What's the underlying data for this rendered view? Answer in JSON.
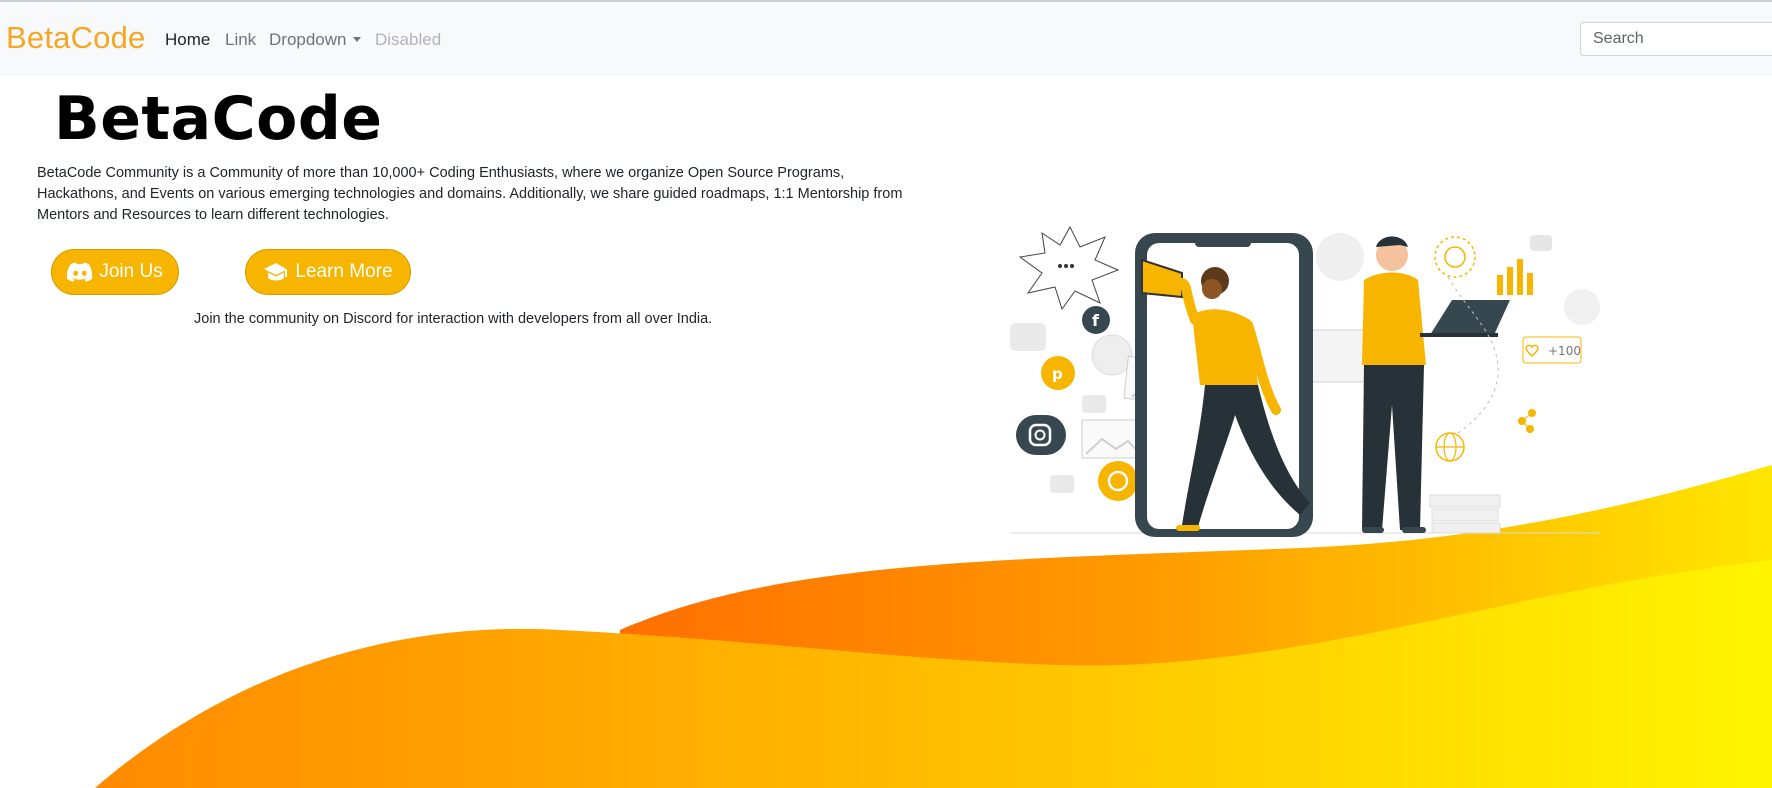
{
  "navbar": {
    "brand": "BetaCode",
    "links": [
      {
        "label": "Home",
        "state": "active"
      },
      {
        "label": "Link",
        "state": "normal"
      },
      {
        "label": "Dropdown",
        "state": "dropdown"
      },
      {
        "label": "Disabled",
        "state": "disabled"
      }
    ],
    "search_placeholder": "Search"
  },
  "hero": {
    "title": "BetaCode",
    "description": "BetaCode Community is a Community of more than 10,000+ Coding Enthusiasts, where we organize Open Source Programs, Hackathons, and Events on various emerging technologies and domains. Additionally, we share guided roadmaps, 1:1 Mentorship from Mentors and Resources to learn different technologies.",
    "join_button": {
      "label": "Join Us",
      "icon": "discord-icon"
    },
    "learn_button": {
      "label": "Learn More",
      "icon": "graduation-cap-icon"
    },
    "subtext": "Join the community on Discord for interaction with developers from all over India."
  },
  "illustration": {
    "badge_text": "+100"
  },
  "colors": {
    "brand": "#f5a623",
    "button": "#f7b500",
    "wave_orange": "#ff7a00",
    "wave_yellow": "#ffef00"
  }
}
